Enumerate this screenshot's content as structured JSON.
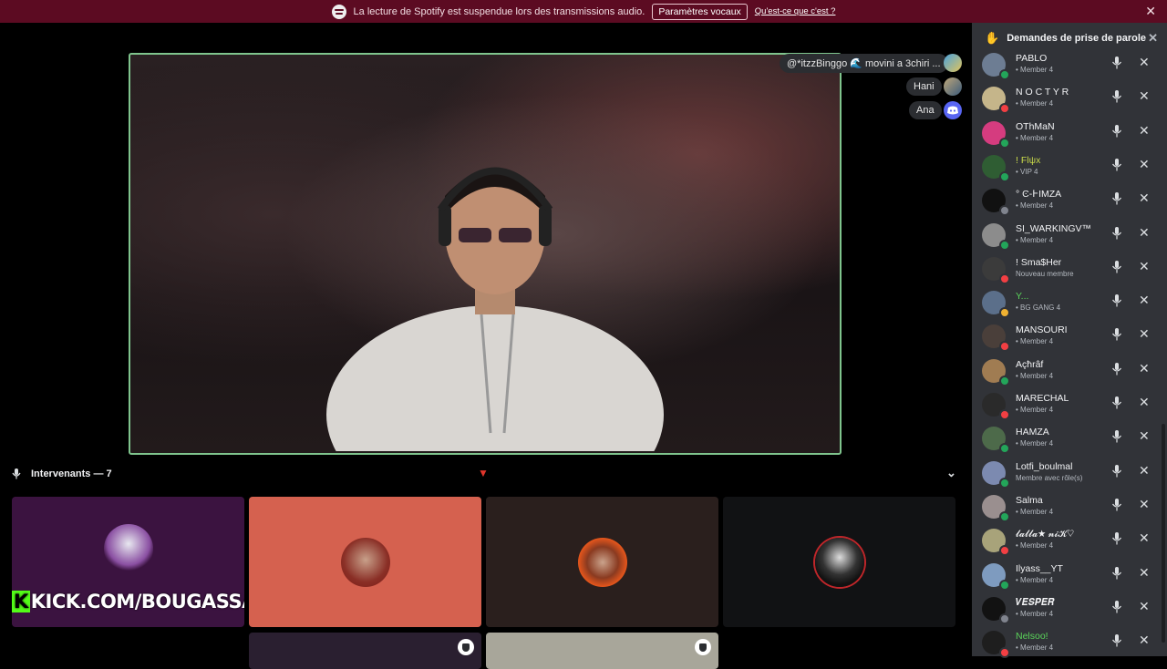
{
  "notice": {
    "text": "La lecture de Spotify est suspendue lors des transmissions audio.",
    "button": "Paramètres vocaux",
    "link": "Qu'est-ce que c'est ?",
    "close": "✕"
  },
  "stage": {
    "chips": [
      {
        "text": "@*itzzBinggo 🌊 movini a 3chiri ..."
      },
      {
        "text": "Hani"
      },
      {
        "text": "Ana"
      }
    ],
    "speakers_label": "Intervenants — 7",
    "kick_text": "KICK.COM/BOUGASSAA",
    "kick_k": "K"
  },
  "panel": {
    "title": "Demandes de prise de parole",
    "close": "✕",
    "requests": [
      {
        "name": "PABLO",
        "role": "Member 4",
        "name_color": "#f2f3f5",
        "status": "#23a55a",
        "avatar": "#6d7d93"
      },
      {
        "name": "N O C T Y R",
        "role": "Member 4",
        "name_color": "#f2f3f5",
        "status": "#f23f43",
        "avatar": "#c5b58a"
      },
      {
        "name": "OThMaN",
        "role": "Member 4",
        "name_color": "#f2f3f5",
        "status": "#23a55a",
        "avatar": "#d53c7f"
      },
      {
        "name": "! Flψx",
        "role": "VIP 4",
        "name_color": "#c7d84a",
        "status": "#23a55a",
        "avatar": "#2f5d33"
      },
      {
        "name": "° Ͼ-ͰIMZA",
        "role": "Member 4",
        "name_color": "#f2f3f5",
        "status": "#80848e",
        "avatar": "#111111"
      },
      {
        "name": "SI_WARKINGV™",
        "role": "Member 4",
        "name_color": "#f2f3f5",
        "status": "#23a55a",
        "avatar": "#8c8c8c"
      },
      {
        "name": "! Sma$Her",
        "role": "Nouveau membre",
        "name_color": "#f2f3f5",
        "status": "#f23f43",
        "avatar": "#3b3b3b",
        "plain": true
      },
      {
        "name": "Y...",
        "role": "BG GANG 4",
        "name_color": "#5ad35a",
        "status": "#f0b232",
        "avatar": "#5b6f8a"
      },
      {
        "name": "MANSOURI",
        "role": "Member 4",
        "name_color": "#f2f3f5",
        "status": "#f23f43",
        "avatar": "#4a3f3a"
      },
      {
        "name": "Açħrâf",
        "role": "Member 4",
        "name_color": "#f2f3f5",
        "status": "#23a55a",
        "avatar": "#a07c52"
      },
      {
        "name": "MARECHAL",
        "role": "Member 4",
        "name_color": "#f2f3f5",
        "status": "#f23f43",
        "avatar": "#2a2a2a"
      },
      {
        "name": "HAMZA",
        "role": "Member 4",
        "name_color": "#f2f3f5",
        "status": "#23a55a",
        "avatar": "#4d6a4a"
      },
      {
        "name": "Lotfi_boulmal",
        "role": "Membre avec rôle(s)",
        "name_color": "#f2f3f5",
        "status": "#23a55a",
        "avatar": "#7c8ab0",
        "plain": true
      },
      {
        "name": "Salma",
        "role": "Member 4",
        "name_color": "#f2f3f5",
        "status": "#23a55a",
        "avatar": "#9a8f8f"
      },
      {
        "name": "𝓵𝓪𝓵𝓵𝓪★ 𝓷𝓲𝓚♡",
        "role": "Member 4",
        "name_color": "#f2f3f5",
        "status": "#f23f43",
        "avatar": "#a8a37a"
      },
      {
        "name": "Ilyass__YT",
        "role": "Member 4",
        "name_color": "#f2f3f5",
        "status": "#23a55a",
        "avatar": "#7e9bbf"
      },
      {
        "name": "𝑽𝑬𝑺𝑷𝑬𝑹",
        "role": "Member 4",
        "name_color": "#f2f3f5",
        "status": "#80848e",
        "avatar": "#121212"
      },
      {
        "name": "Nelsoo!",
        "role": "Member 4",
        "name_color": "#5ad35a",
        "status": "#f23f43",
        "avatar": "#1e1e1e"
      }
    ]
  }
}
